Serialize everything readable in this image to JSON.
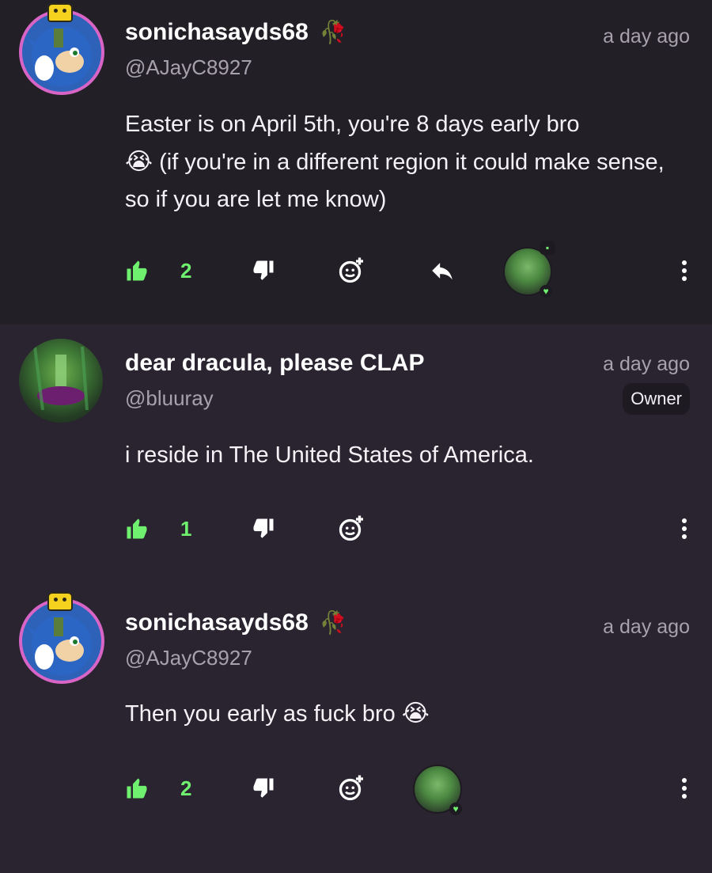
{
  "colors": {
    "accent": "#6ff06f",
    "avatar_ring": "#d864c6",
    "background": "#2a2430"
  },
  "comments": [
    {
      "username": "sonichasayds68",
      "username_decoration": "🥀",
      "handle": "@AJayC8927",
      "time": "a day ago",
      "body_line1": "Easter is on April 5th, you're 8 days early bro",
      "body_emoji": "😭",
      "body_line2": " (if you're in a different region it could make sense, so if you are let me know)",
      "likes": "2",
      "icons": [
        "thumbs-up-icon",
        "thumbs-down-icon",
        "add-reaction-icon",
        "reply-icon",
        "more-icon"
      ]
    },
    {
      "username": "dear dracula, please CLAP",
      "handle": "@bluuray",
      "time": "a day ago",
      "badge": "Owner",
      "body": "i reside in The United States of America.",
      "likes": "1",
      "icons": [
        "thumbs-up-icon",
        "thumbs-down-icon",
        "add-reaction-icon",
        "more-icon"
      ]
    },
    {
      "username": "sonichasayds68",
      "username_decoration": "🥀",
      "handle": "@AJayC8927",
      "time": "a day ago",
      "body": "Then you early as fuck bro",
      "body_emoji": "😭",
      "likes": "2",
      "icons": [
        "thumbs-up-icon",
        "thumbs-down-icon",
        "add-reaction-icon",
        "more-icon"
      ]
    }
  ]
}
